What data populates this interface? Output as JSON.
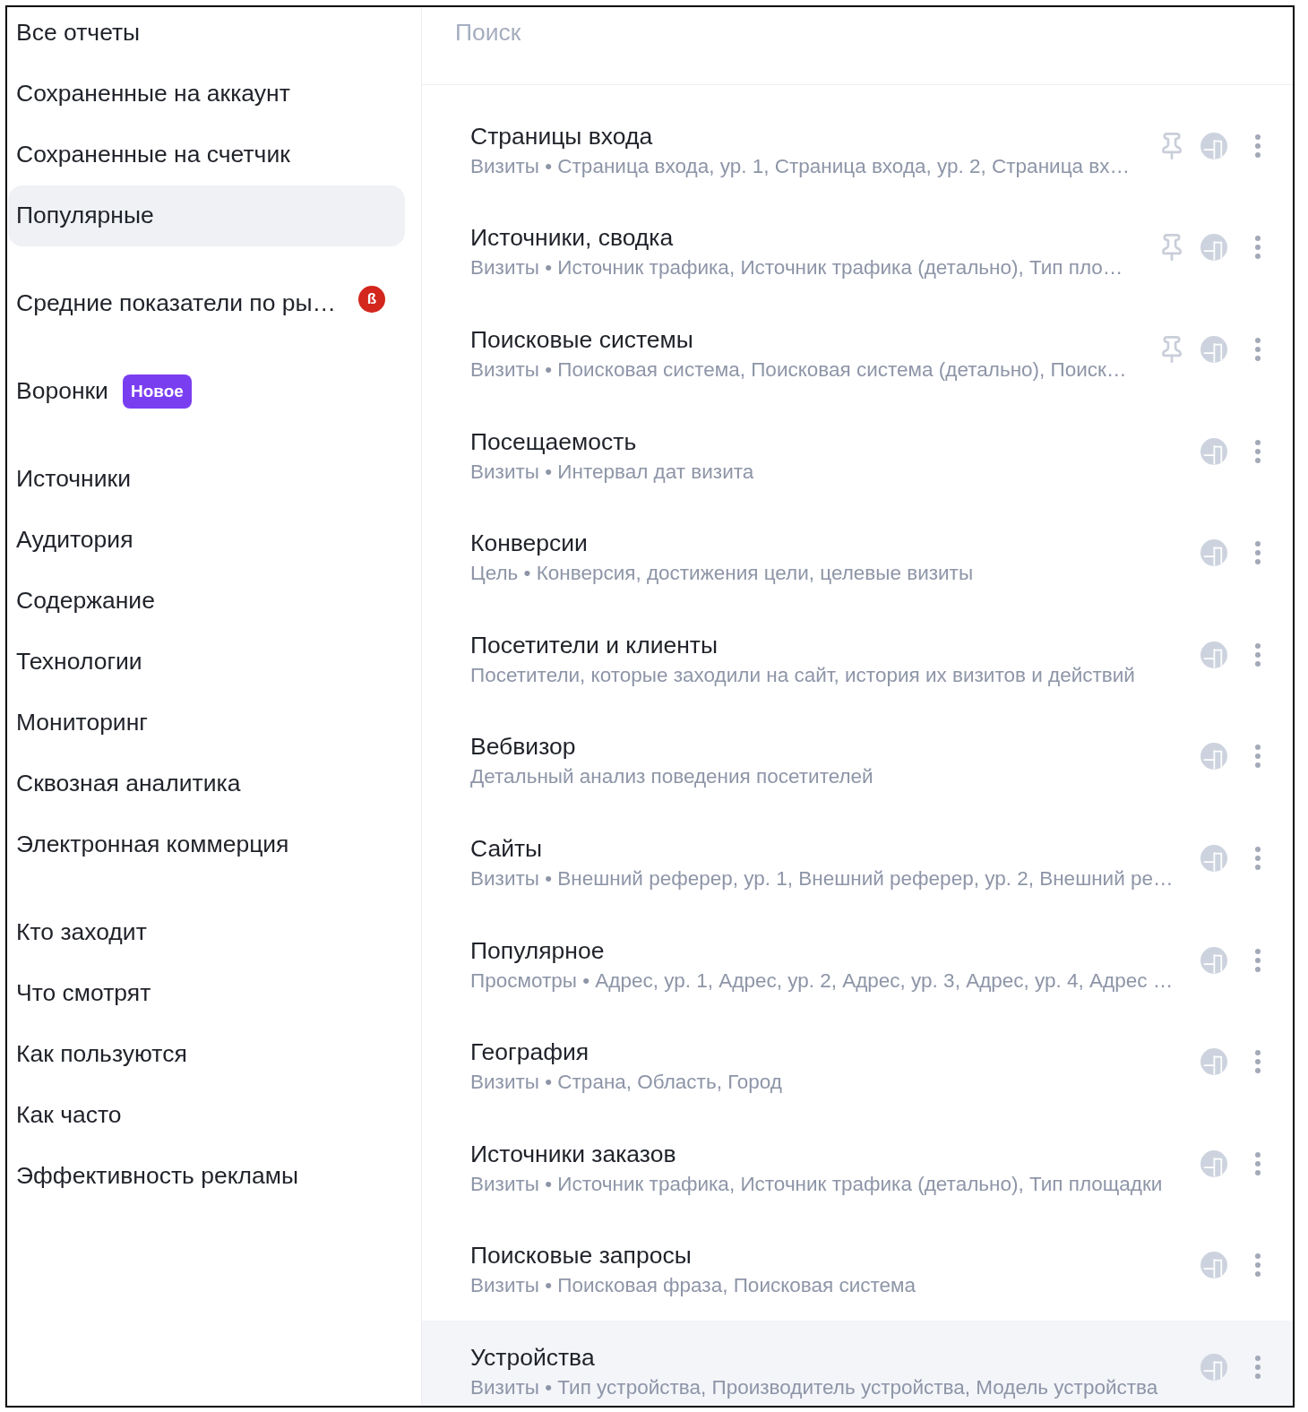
{
  "sidebar": {
    "groups": [
      {
        "items": [
          {
            "label": "Все отчеты",
            "selected": false
          },
          {
            "label": "Сохраненные на аккаунт",
            "selected": false
          },
          {
            "label": "Сохраненные на счетчик",
            "selected": false
          },
          {
            "label": "Популярные",
            "selected": true
          }
        ]
      },
      {
        "items": [
          {
            "label": "Средние показатели по ры…",
            "selected": false,
            "badge": {
              "kind": "beta",
              "text": "ß"
            }
          }
        ]
      },
      {
        "items": [
          {
            "label": "Воронки",
            "selected": false,
            "badge": {
              "kind": "new",
              "text": "Новое"
            }
          }
        ]
      },
      {
        "items": [
          {
            "label": "Источники",
            "selected": false
          },
          {
            "label": "Аудитория",
            "selected": false
          },
          {
            "label": "Содержание",
            "selected": false
          },
          {
            "label": "Технологии",
            "selected": false
          },
          {
            "label": "Мониторинг",
            "selected": false
          },
          {
            "label": "Сквозная аналитика",
            "selected": false
          },
          {
            "label": "Электронная коммерция",
            "selected": false
          }
        ]
      },
      {
        "items": [
          {
            "label": "Кто заходит",
            "selected": false
          },
          {
            "label": "Что смотрят",
            "selected": false
          },
          {
            "label": "Как пользуются",
            "selected": false
          },
          {
            "label": "Как часто",
            "selected": false
          },
          {
            "label": "Эффективность рекламы",
            "selected": false
          }
        ]
      }
    ]
  },
  "search": {
    "placeholder": "Поиск"
  },
  "reports": [
    {
      "title": "Страницы входа",
      "description": "Визиты • Страница входа, ур. 1, Страница входа, ур. 2, Страница вх…",
      "pin": true,
      "hovered": false
    },
    {
      "title": "Источники, сводка",
      "description": "Визиты • Источник трафика, Источник трафика (детально), Тип пло…",
      "pin": true,
      "hovered": false
    },
    {
      "title": "Поисковые системы",
      "description": "Визиты • Поисковая система, Поисковая система (детально), Поиск…",
      "pin": true,
      "hovered": false
    },
    {
      "title": "Посещаемость",
      "description": "Визиты • Интервал дат визита",
      "pin": false,
      "hovered": false
    },
    {
      "title": "Конверсии",
      "description": "Цель • Конверсия, достижения цели, целевые визиты",
      "pin": false,
      "hovered": false
    },
    {
      "title": "Посетители и клиенты",
      "description": "Посетители, которые заходили на сайт, история их визитов и действий",
      "pin": false,
      "hovered": false
    },
    {
      "title": "Вебвизор",
      "description": "Детальный анализ поведения посетителей",
      "pin": false,
      "hovered": false
    },
    {
      "title": "Сайты",
      "description": "Визиты • Внешний реферер, ур. 1, Внешний реферер, ур. 2, Внешний ре…",
      "pin": false,
      "hovered": false
    },
    {
      "title": "Популярное",
      "description": "Просмотры • Адрес, ур. 1, Адрес, ур. 2, Адрес, ур. 3, Адрес, ур. 4, Адрес …",
      "pin": false,
      "hovered": false
    },
    {
      "title": "География",
      "description": "Визиты • Страна, Область, Город",
      "pin": false,
      "hovered": false
    },
    {
      "title": "Источники заказов",
      "description": "Визиты • Источник трафика, Источник трафика (детально), Тип площадки",
      "pin": false,
      "hovered": false
    },
    {
      "title": "Поисковые запросы",
      "description": "Визиты • Поисковая фраза, Поисковая система",
      "pin": false,
      "hovered": false
    },
    {
      "title": "Устройства",
      "description": "Визиты • Тип устройства, Производитель устройства, Модель устройства",
      "pin": false,
      "hovered": true
    }
  ]
}
